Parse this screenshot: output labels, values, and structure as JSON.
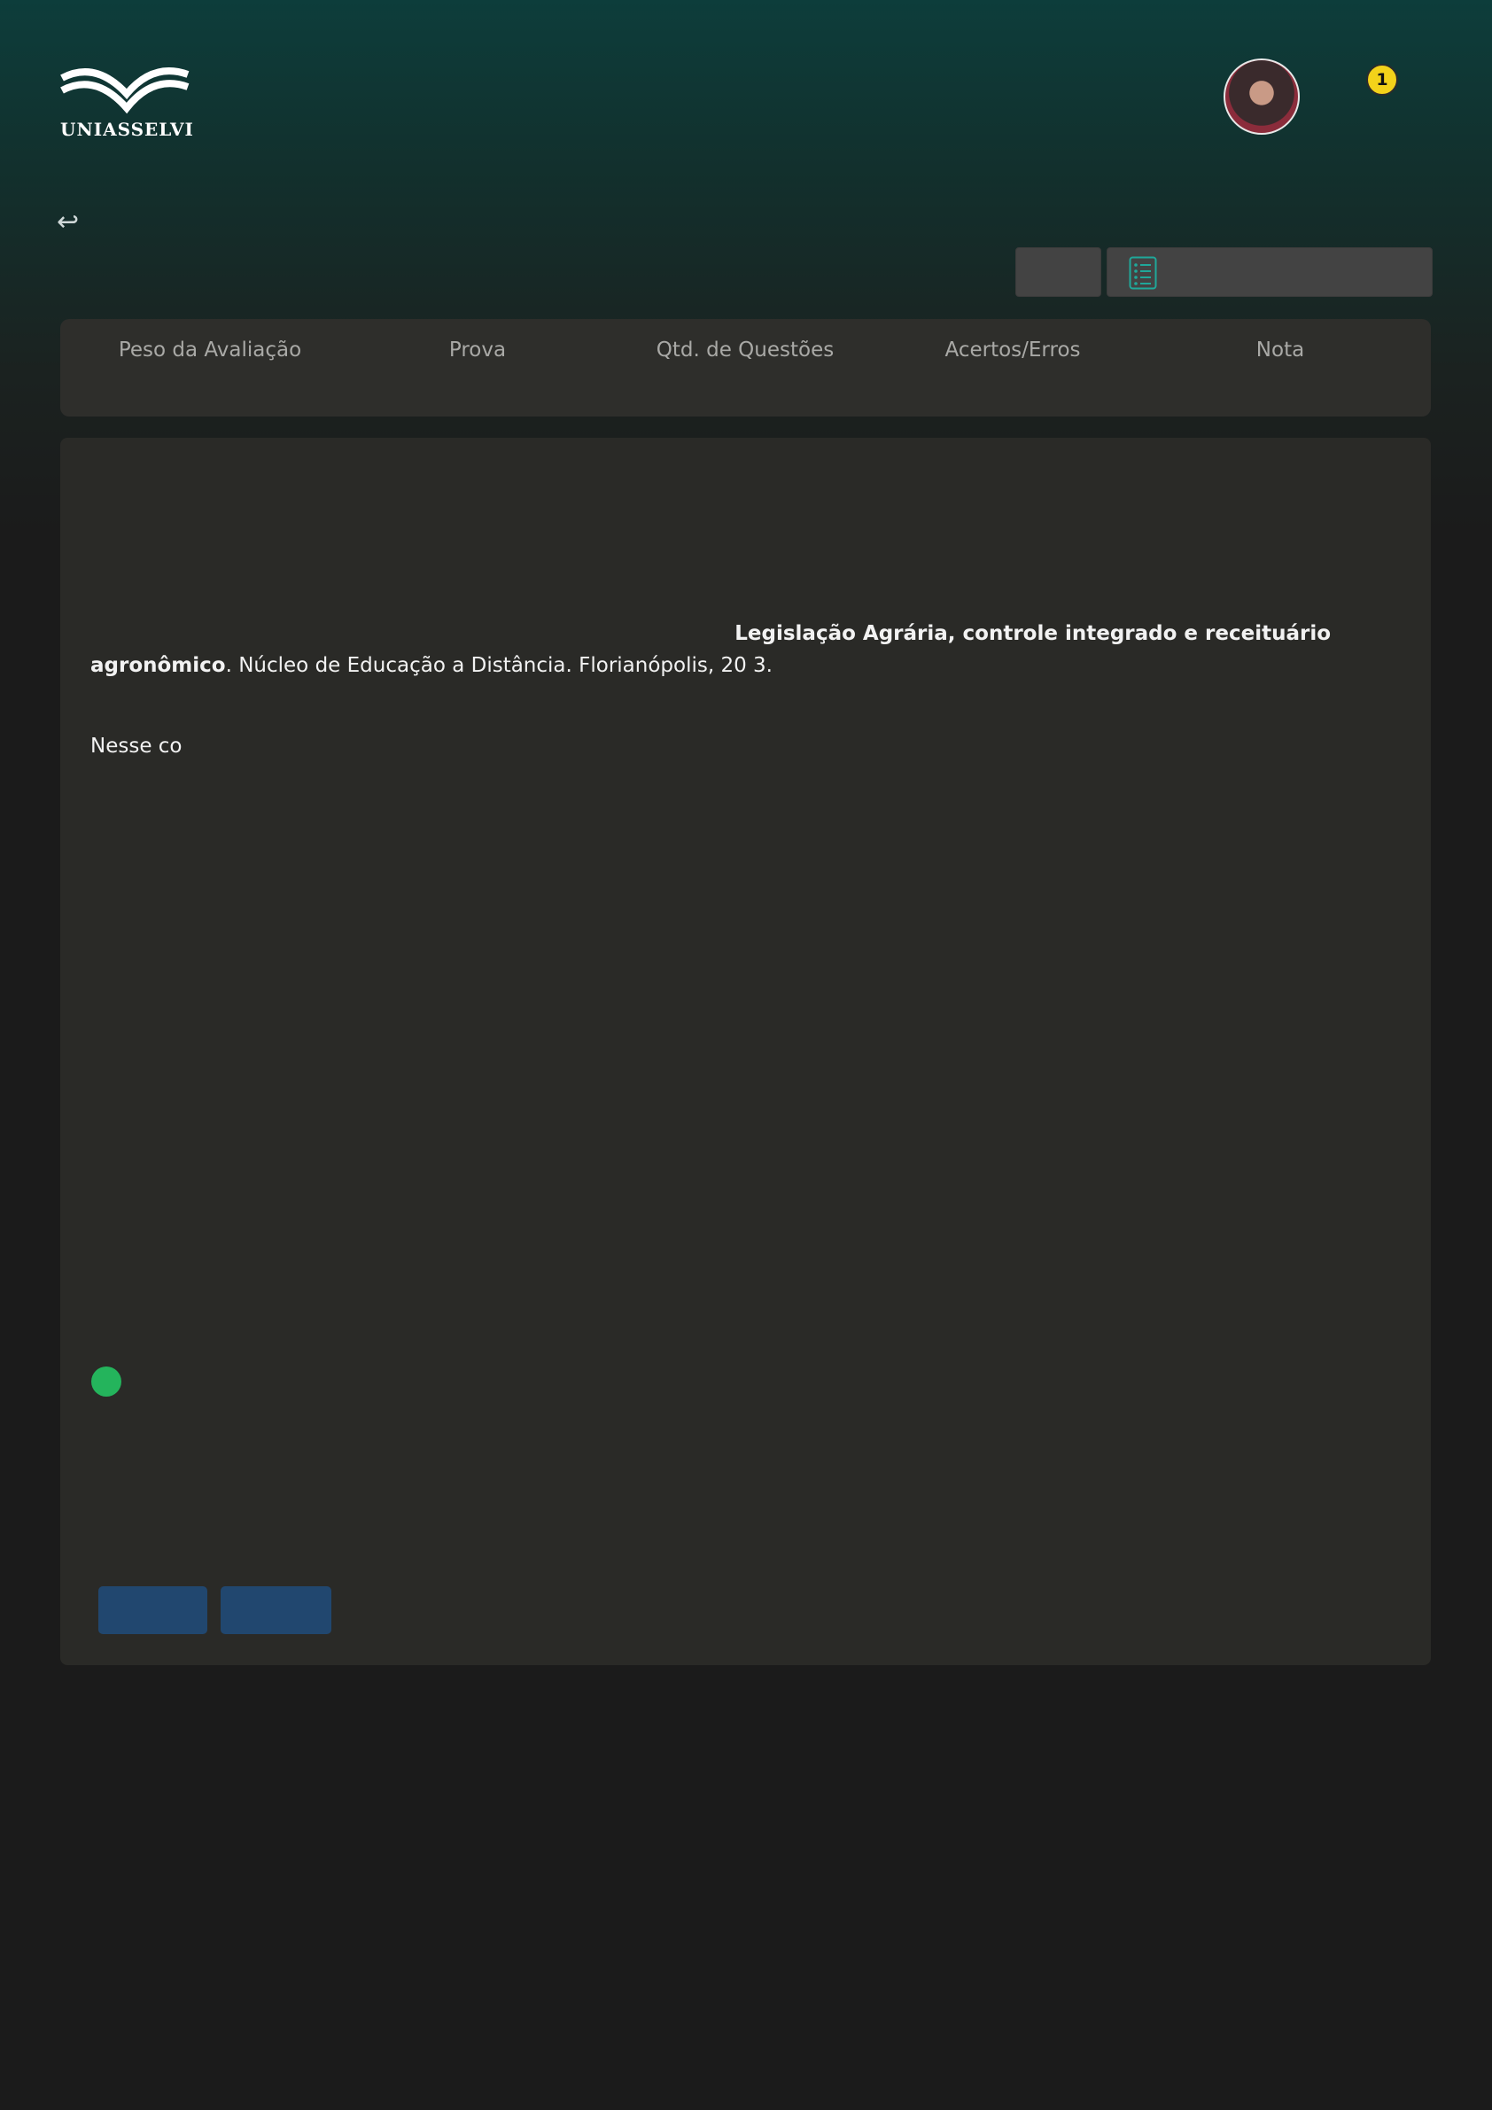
{
  "header": {
    "brand": "UNIASSELVI",
    "notification_count": "1"
  },
  "icons": {
    "back": "return-arrow-icon",
    "list": "list-icon",
    "brand_accent": "#1fa89a"
  },
  "summary": {
    "columns": [
      "Peso da Avaliação",
      "Prova",
      "Qtd. de Questões",
      "Acertos/Erros",
      "Nota"
    ]
  },
  "question": {
    "reference_title_part1": "Legislação Agrária, controle integrado e receituário",
    "reference_title_part2": "agronômico",
    "reference_rest": ". Núcleo de Educação a Distância. Florianópolis, 20  3.",
    "prompt_start": "Nesse co"
  },
  "colors": {
    "selected_option": "#24b45c",
    "primary_button": "#21476f",
    "notification_badge": "#f3d21a"
  }
}
